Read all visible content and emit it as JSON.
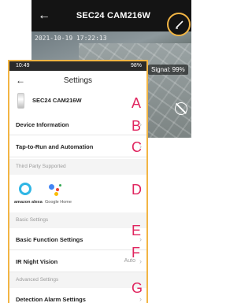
{
  "camera_view": {
    "title": "SEC24 CAM216W",
    "timestamp": "2021-10-19 17:22:13",
    "signal": "Signal: 99%"
  },
  "status_bar": {
    "time": "10:49",
    "battery": "98%"
  },
  "settings": {
    "title": "Settings",
    "device_name": "SEC24 CAM216W",
    "rows": {
      "device_information": "Device Information",
      "tap_to_run": "Tap-to-Run and Automation",
      "basic_function": "Basic Function Settings",
      "ir_night_vision": "IR Night Vision",
      "ir_night_vision_value": "Auto",
      "detection_alarm": "Detection Alarm Settings"
    },
    "sections": {
      "third_party": "Third Party Supported",
      "basic": "Basic Settings",
      "advanced": "Advanced Settings"
    },
    "third_party": {
      "alexa": "amazon alexa",
      "google": "Google Home"
    }
  },
  "annotations": {
    "a": "A",
    "b": "B",
    "c": "C",
    "d": "D",
    "e": "E",
    "f": "F",
    "g": "G"
  },
  "colors": {
    "highlight": "#f2b544",
    "annotation": "#e0245e",
    "alexa": "#2fb6e5"
  }
}
